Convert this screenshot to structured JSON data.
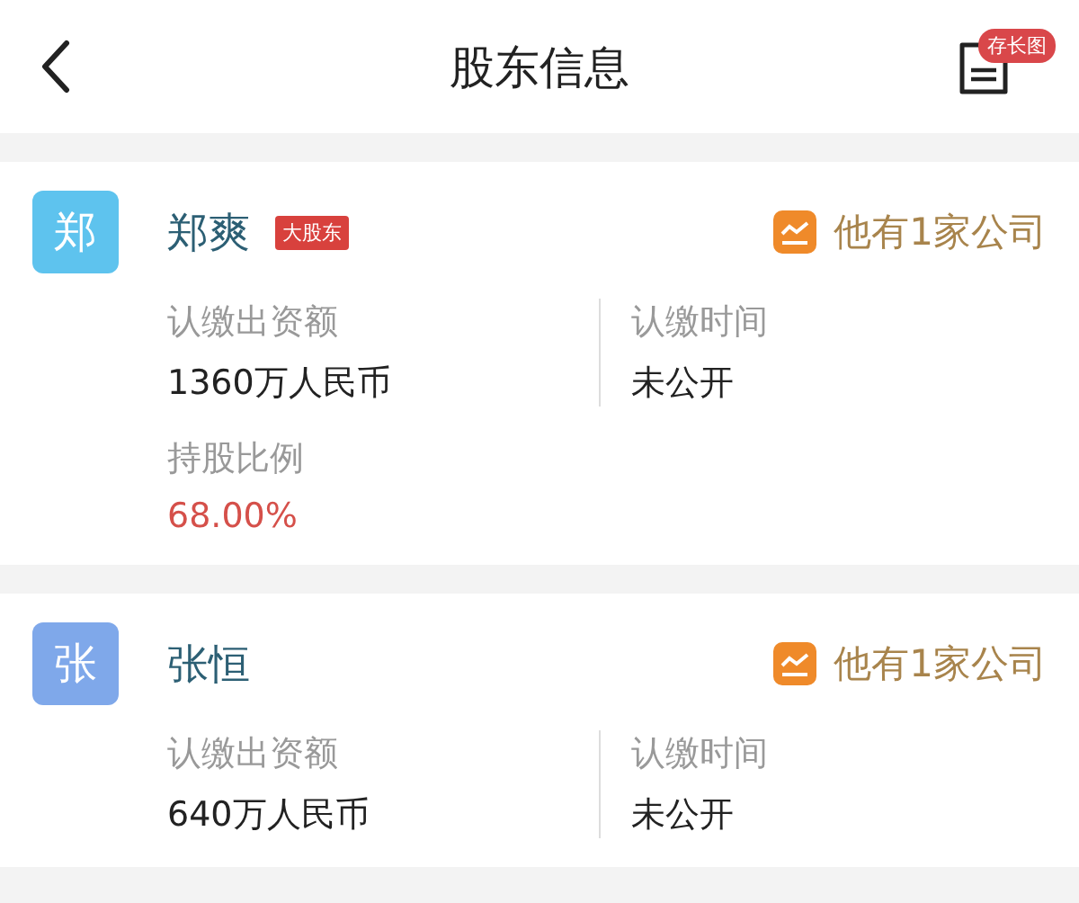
{
  "header": {
    "title": "股东信息",
    "save_badge": "存长图"
  },
  "shareholders": [
    {
      "avatar_char": "郑",
      "color": "#5ec3ee",
      "name": "郑爽",
      "badge": "大股东",
      "company_link": "他有1家公司",
      "fields": [
        {
          "kind": "plain",
          "label": "认缴出资额",
          "value": "1360万人民币"
        },
        {
          "kind": "plain",
          "label": "认缴时间",
          "value": "未公开"
        },
        {
          "kind": "highlight",
          "label": "持股比例",
          "value": "68.00%"
        }
      ]
    },
    {
      "avatar_char": "张",
      "color": "#7fa8ea",
      "name": "张恒",
      "company_link": "他有1家公司",
      "fields": [
        {
          "kind": "plain",
          "label": "认缴出资额",
          "value": "640万人民币"
        },
        {
          "kind": "plain",
          "label": "认缴时间",
          "value": "未公开"
        }
      ]
    }
  ]
}
